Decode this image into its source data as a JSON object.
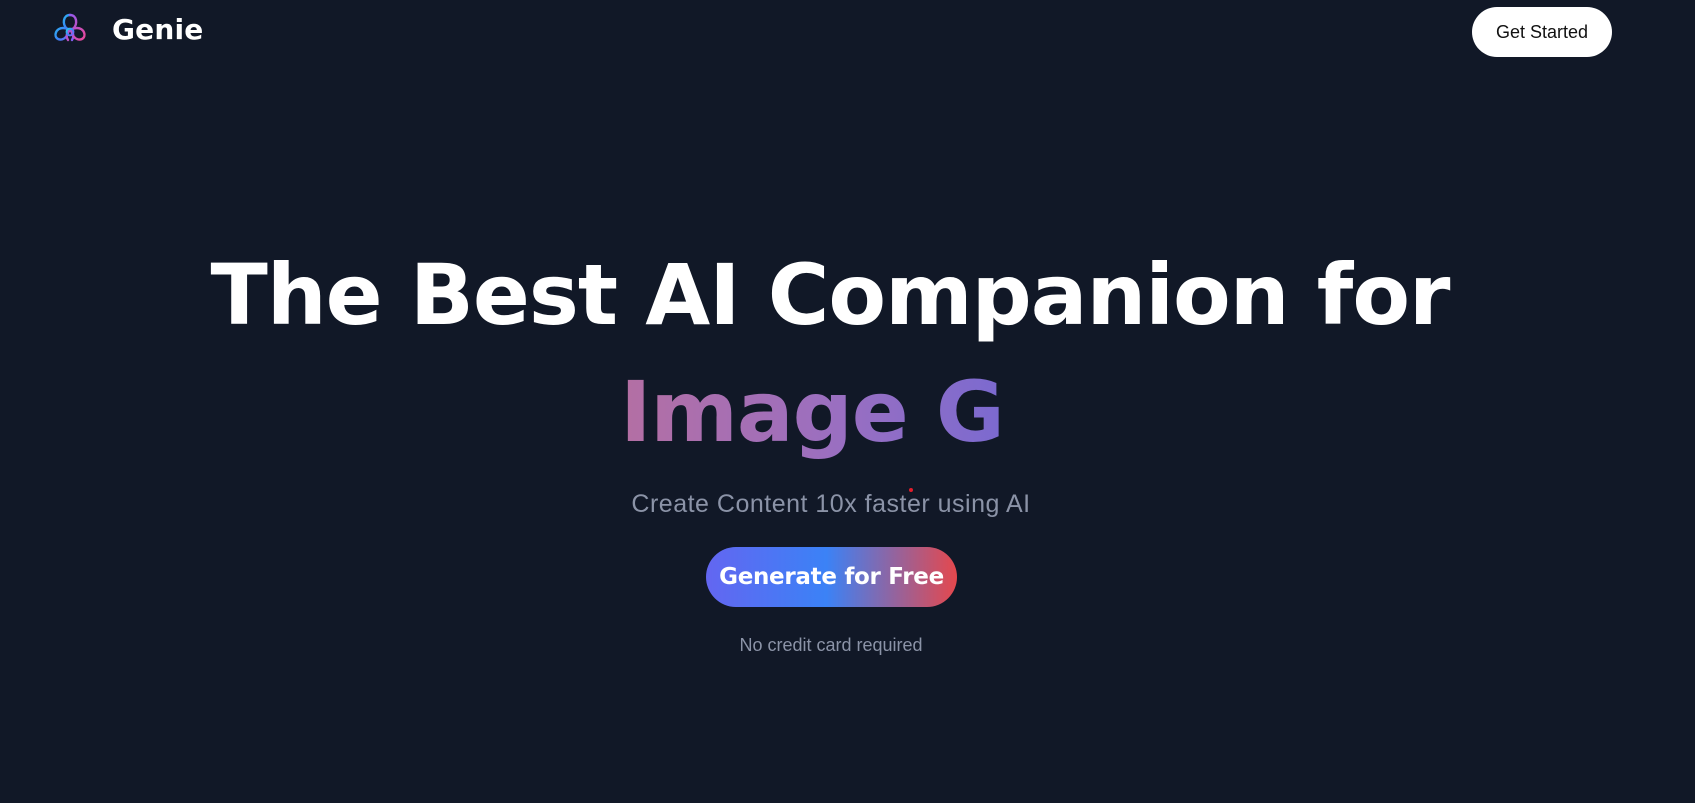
{
  "header": {
    "brand_name": "Genie",
    "logo_icon": "genie-knot-logo",
    "get_started_label": "Get Started"
  },
  "hero": {
    "title_line1": "The Best AI Companion for",
    "title_line2_typed": "Image G",
    "subtitle": "Create Content 10x faster using AI",
    "cta_label": "Generate for Free",
    "note": "No credit card required"
  },
  "colors": {
    "background": "#111827",
    "text_primary": "#ffffff",
    "text_muted": "#8b93a7",
    "cta_gradient": [
      "#6366f1",
      "#3b82f6",
      "#e5484d"
    ],
    "typed_gradient": [
      "#b46fa3",
      "#9b6fc0",
      "#7b6ad0"
    ],
    "logo_gradient": [
      "#22d3ee",
      "#8b5cf6",
      "#ec4899"
    ],
    "top_cta_background": "#ffffff"
  }
}
